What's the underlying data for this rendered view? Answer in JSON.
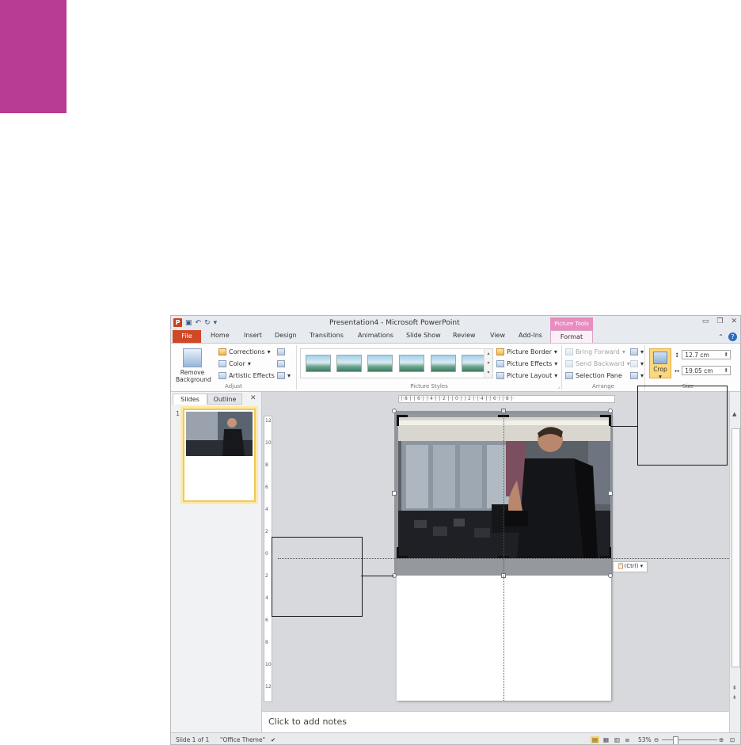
{
  "window": {
    "title": "Presentation4 - Microsoft PowerPoint",
    "context_tab": "Picture Tools"
  },
  "tabs": [
    "File",
    "Home",
    "Insert",
    "Design",
    "Transitions",
    "Animations",
    "Slide Show",
    "Review",
    "View",
    "Add-Ins",
    "Format"
  ],
  "ribbon": {
    "remove_background": "Remove Background",
    "corrections": "Corrections",
    "color": "Color",
    "artistic_effects": "Artistic Effects",
    "adjust_label": "Adjust",
    "picture_styles_label": "Picture Styles",
    "picture_border": "Picture Border",
    "picture_effects": "Picture Effects",
    "picture_layout": "Picture Layout",
    "bring_forward": "Bring Forward",
    "send_backward": "Send Backward",
    "selection_pane": "Selection Pane",
    "arrange_label": "Arrange",
    "crop": "Crop",
    "height": "12.7 cm",
    "width": "19.05 cm",
    "size_label": "Size"
  },
  "slides_pane": {
    "tab_slides": "Slides",
    "tab_outline": "Outline",
    "slide_number": "1"
  },
  "ruler": {
    "horizontal": "·|·8·|·|·6·|·|·4·|·|·2·|·|·0·|·|·2·|·|·4·|·|·6·|·|·8·|·",
    "vertical": [
      "12",
      "10",
      "8",
      "6",
      "4",
      "2",
      "0",
      "2",
      "4",
      "6",
      "8",
      "10",
      "12"
    ]
  },
  "paste_options": "(Ctrl)",
  "notes_placeholder": "Click to add notes",
  "status": {
    "slide": "Slide 1 of 1",
    "theme": "\"Office Theme\"",
    "zoom": "53%"
  },
  "colors": {
    "accent_magenta": "#b83b94",
    "file_tab": "#d24726",
    "crop_active": "#fbd77e"
  }
}
